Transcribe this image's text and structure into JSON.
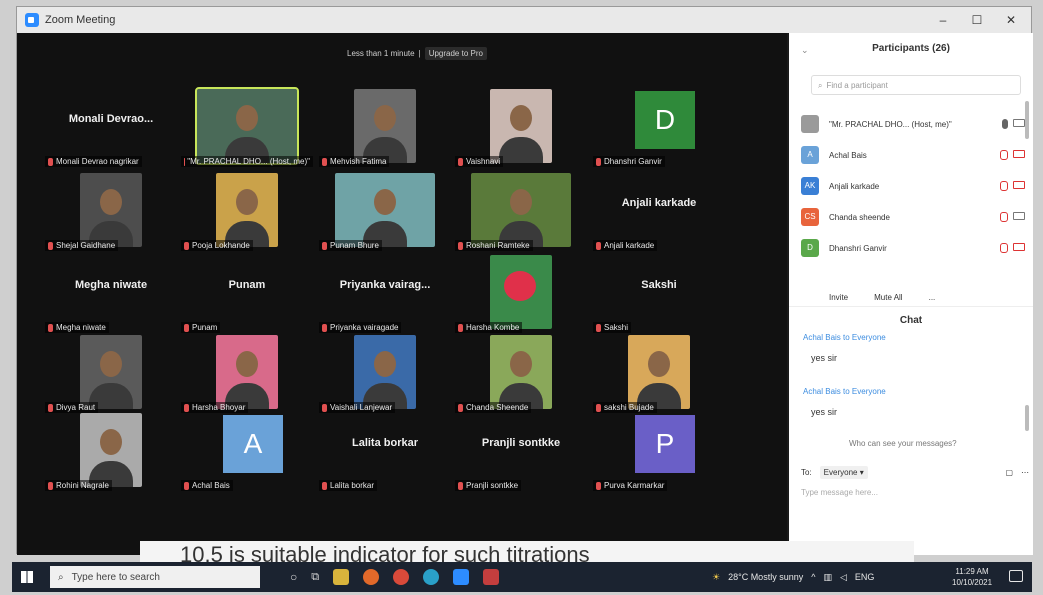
{
  "window": {
    "title": "Zoom Meeting",
    "min": "–",
    "max": "☐",
    "close": "✕"
  },
  "banner": {
    "time_text": "Less than 1 minute",
    "upgrade_label": "Upgrade to Pro"
  },
  "tiles": [
    {
      "label": "Monali Devrao nagrikar",
      "display": "Monali Devrao..."
    },
    {
      "label": "\"Mr. PRACHAL DHO... (Host, me)\"",
      "display": ""
    },
    {
      "label": "Mehvish Fatima",
      "display": ""
    },
    {
      "label": "Vaishnavi",
      "display": ""
    },
    {
      "label": "Dhanshri Ganvir",
      "display": "",
      "avatar": "D"
    },
    {
      "label": "Shejal Gaidhane",
      "display": ""
    },
    {
      "label": "Pooja Lokhande",
      "display": ""
    },
    {
      "label": "Punam Bhure",
      "display": ""
    },
    {
      "label": "Roshani Ramteke",
      "display": ""
    },
    {
      "label": "Anjali karkade",
      "display": "Anjali karkade"
    },
    {
      "label": "Megha niwate",
      "display": "Megha niwate"
    },
    {
      "label": "Punam",
      "display": "Punam"
    },
    {
      "label": "Priyanka vairagade",
      "display": "Priyanka vairag..."
    },
    {
      "label": "Harsha Kombe",
      "display": ""
    },
    {
      "label": "Sakshi",
      "display": "Sakshi"
    },
    {
      "label": "Divya Raut",
      "display": ""
    },
    {
      "label": "Harsha Bhoyar",
      "display": ""
    },
    {
      "label": "Vaishali Lanjewar",
      "display": ""
    },
    {
      "label": "Chanda Sheende",
      "display": ""
    },
    {
      "label": "sakshi Bujade",
      "display": ""
    },
    {
      "label": "Rohini Nagrale",
      "display": ""
    },
    {
      "label": "Achal Bais",
      "display": "",
      "avatar": "A"
    },
    {
      "label": "Lalita borkar",
      "display": "Lalita borkar"
    },
    {
      "label": "Pranjli sontkke",
      "display": "Pranjli sontkke"
    },
    {
      "label": "Purva Karmarkar",
      "display": "",
      "avatar": "P"
    }
  ],
  "participants": {
    "header": "Participants (26)",
    "find_placeholder": "Find a participant",
    "list": [
      {
        "initials": "",
        "name": "\"Mr. PRACHAL DHO... (Host, me)\"",
        "color": "#9a9a9a",
        "mic": "on",
        "cam": "on"
      },
      {
        "initials": "A",
        "name": "Achal Bais",
        "color": "#6aa2d8",
        "mic": "off",
        "cam": "off"
      },
      {
        "initials": "AK",
        "name": "Anjali karkade",
        "color": "#3a7fd5",
        "mic": "off",
        "cam": "off"
      },
      {
        "initials": "CS",
        "name": "Chanda sheende",
        "color": "#e8643c",
        "mic": "off",
        "cam": "on"
      },
      {
        "initials": "D",
        "name": "Dhanshri Ganvir",
        "color": "#5aa84a",
        "mic": "off",
        "cam": "off"
      }
    ],
    "invite_label": "Invite",
    "mute_all_label": "Mute All",
    "more_label": "..."
  },
  "chat": {
    "header": "Chat",
    "messages": [
      {
        "from": "Achal Bais to Everyone",
        "text": "yes sir"
      },
      {
        "from": "Achal Bais to Everyone",
        "text": "yes sir"
      }
    ],
    "who_can_see": "Who can see your messages?",
    "to_label": "To:",
    "recipient": "Everyone ▾",
    "placeholder": "Type message here..."
  },
  "subtitle": "10.5 is suitable indicator for such titrations",
  "taskbar": {
    "search_placeholder": "Type here to search",
    "weather": "28°C  Mostly sunny",
    "lang": "ENG",
    "time": "11:29 AM",
    "date": "10/10/2021"
  },
  "colors": {
    "gallery_bg": "#111111",
    "active_speaker": "#c8e65a",
    "zoom_blue": "#2d8cff",
    "avatar_d": "#2f8a3a",
    "avatar_a": "#6aa2d8",
    "avatar_p": "#6a5fc7"
  }
}
